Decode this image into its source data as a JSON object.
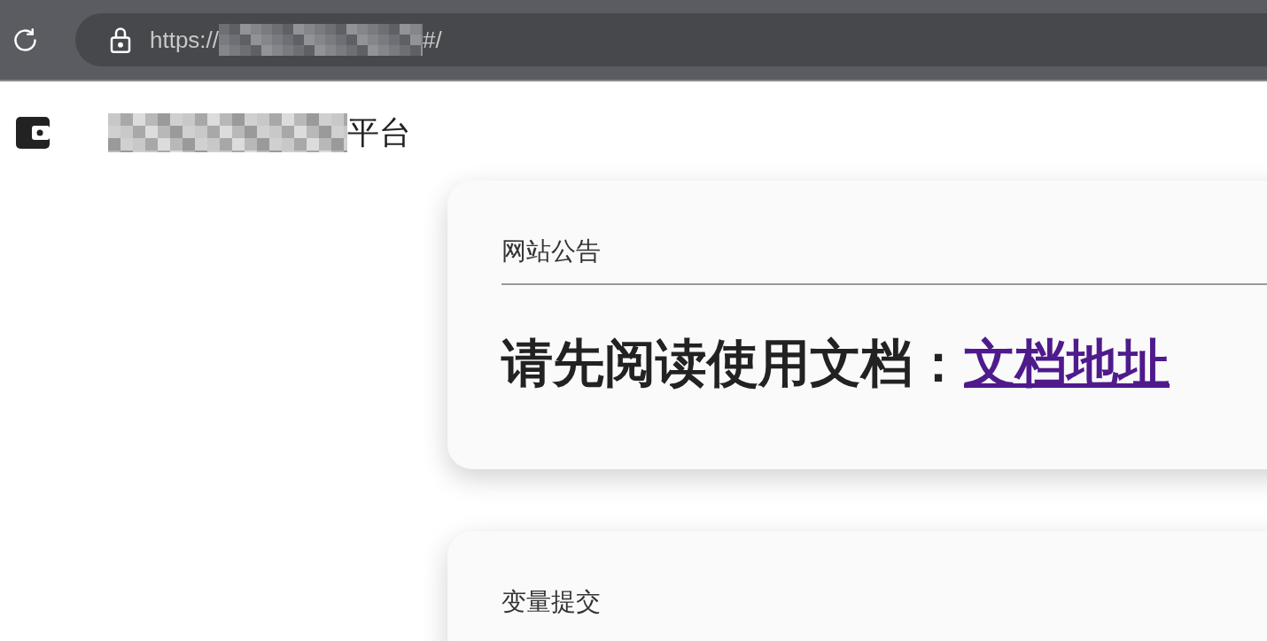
{
  "browser": {
    "url_start": "https://",
    "url_end": "#/"
  },
  "header": {
    "title_end": "平台"
  },
  "cards": [
    {
      "title": "网站公告",
      "heading": "请先阅读使用文档：",
      "link": "文档地址"
    },
    {
      "title": "变量提交"
    }
  ]
}
